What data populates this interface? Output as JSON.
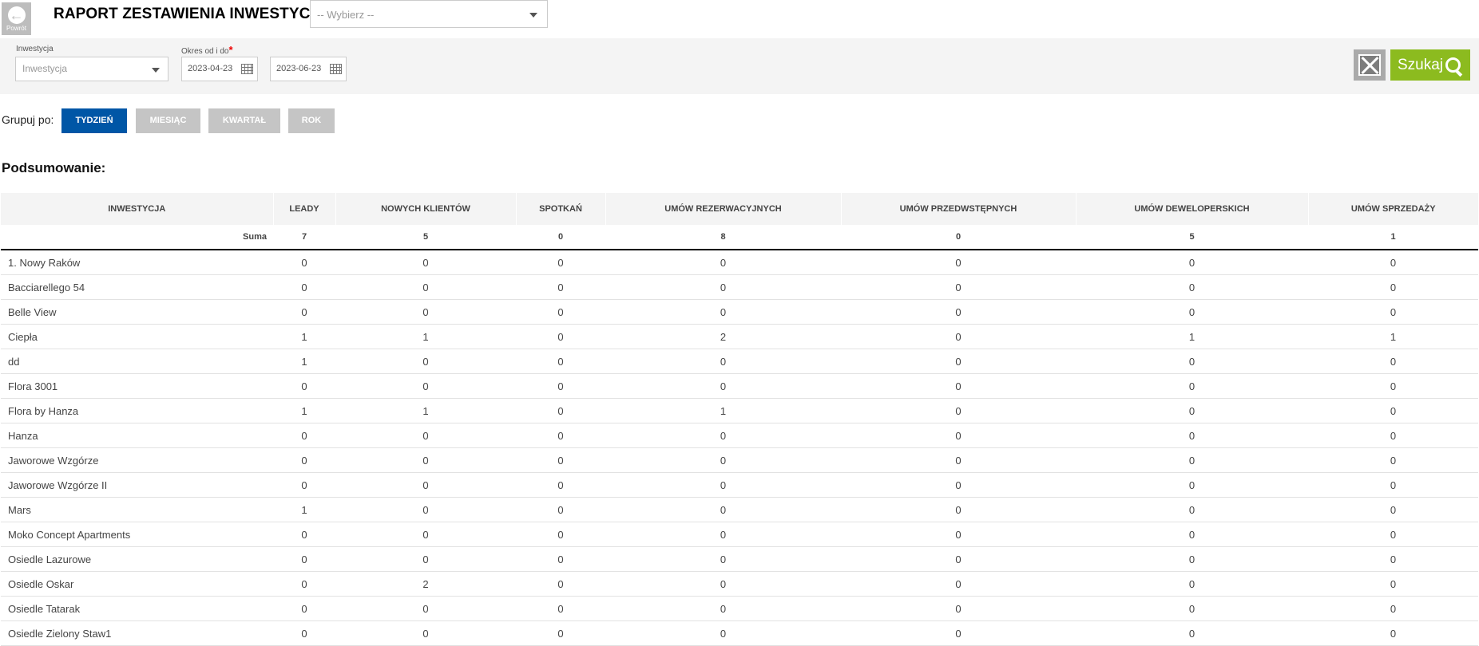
{
  "header": {
    "back_label": "Powrót",
    "title": "RAPORT ZESTAWIENIA INWESTYCJI",
    "select_placeholder": "-- Wybierz --"
  },
  "filters": {
    "investment_label": "Inwestycja",
    "investment_placeholder": "Inwestycja",
    "period_label": "Okres od i do",
    "required_mark": "*",
    "date_from": "2023-04-23",
    "date_to": "2023-06-23",
    "search_label": "Szukaj"
  },
  "group_by": {
    "label": "Grupuj po:",
    "options": [
      "TYDZIEŃ",
      "MIESIĄC",
      "KWARTAŁ",
      "ROK"
    ],
    "selected": "TYDZIEŃ"
  },
  "summary_title": "Podsumowanie:",
  "table": {
    "headers": [
      "Inwestycja",
      "Leady",
      "Nowych klientów",
      "Spotkań",
      "Umów rezerwacyjnych",
      "Umów przedwstępnych",
      "Umów deweloperskich",
      "Umów sprzedaży"
    ],
    "sum_row": [
      "Suma",
      "7",
      "5",
      "0",
      "8",
      "0",
      "5",
      "1"
    ],
    "rows": [
      [
        "1. Nowy Raków",
        "0",
        "0",
        "0",
        "0",
        "0",
        "0",
        "0"
      ],
      [
        "Bacciarellego 54",
        "0",
        "0",
        "0",
        "0",
        "0",
        "0",
        "0"
      ],
      [
        "Belle View",
        "0",
        "0",
        "0",
        "0",
        "0",
        "0",
        "0"
      ],
      [
        "Ciepła",
        "1",
        "1",
        "0",
        "2",
        "0",
        "1",
        "1"
      ],
      [
        "dd",
        "1",
        "0",
        "0",
        "0",
        "0",
        "0",
        "0"
      ],
      [
        "Flora 3001",
        "0",
        "0",
        "0",
        "0",
        "0",
        "0",
        "0"
      ],
      [
        "Flora by Hanza",
        "1",
        "1",
        "0",
        "1",
        "0",
        "0",
        "0"
      ],
      [
        "Hanza",
        "0",
        "0",
        "0",
        "0",
        "0",
        "0",
        "0"
      ],
      [
        "Jaworowe Wzgórze",
        "0",
        "0",
        "0",
        "0",
        "0",
        "0",
        "0"
      ],
      [
        "Jaworowe Wzgórze II",
        "0",
        "0",
        "0",
        "0",
        "0",
        "0",
        "0"
      ],
      [
        "Mars",
        "1",
        "0",
        "0",
        "0",
        "0",
        "0",
        "0"
      ],
      [
        "Moko Concept Apartments",
        "0",
        "0",
        "0",
        "0",
        "0",
        "0",
        "0"
      ],
      [
        "Osiedle Lazurowe",
        "0",
        "0",
        "0",
        "0",
        "0",
        "0",
        "0"
      ],
      [
        "Osiedle Oskar",
        "0",
        "2",
        "0",
        "0",
        "0",
        "0",
        "0"
      ],
      [
        "Osiedle Tatarak",
        "0",
        "0",
        "0",
        "0",
        "0",
        "0",
        "0"
      ],
      [
        "Osiedle Zielony Staw1",
        "0",
        "0",
        "0",
        "0",
        "0",
        "0",
        "0"
      ]
    ]
  },
  "colors": {
    "active_group": "#0056a6",
    "search_button": "#8cbb1f",
    "inactive_group": "#c5c5c5"
  }
}
